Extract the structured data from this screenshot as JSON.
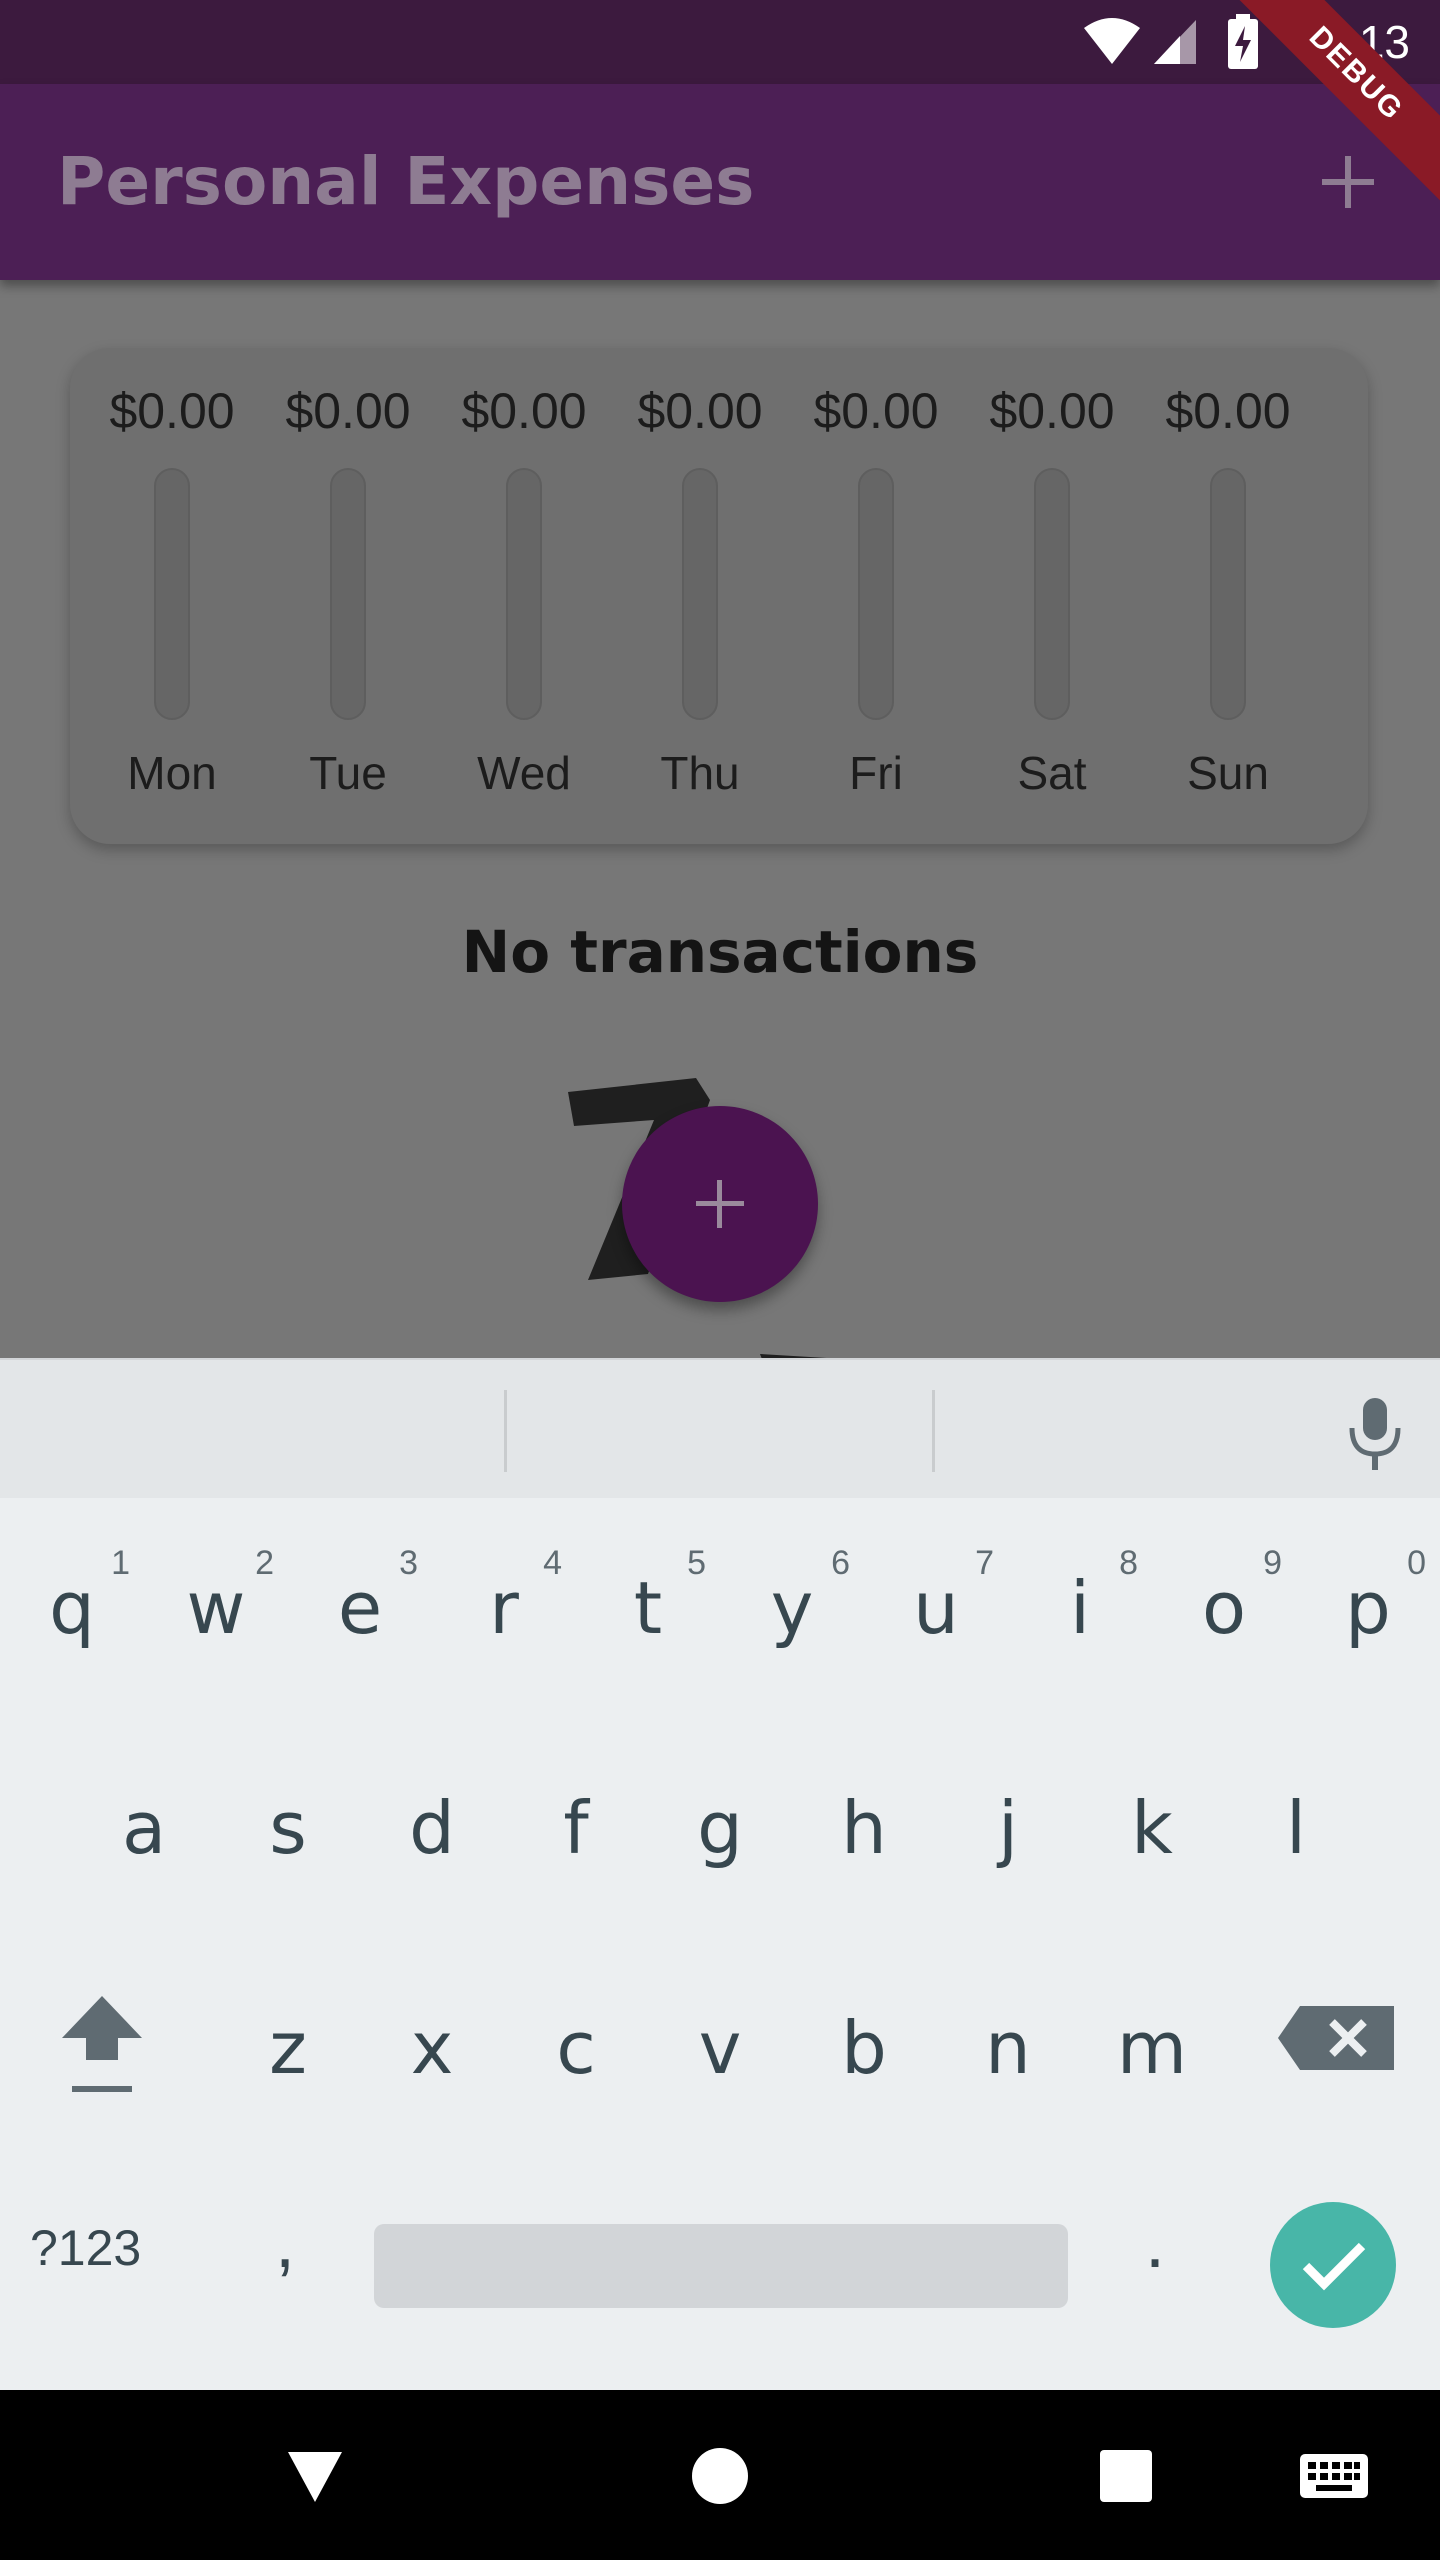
{
  "status_bar": {
    "time": "10:13",
    "icons": [
      "wifi-icon",
      "signal-icon",
      "battery-charging-icon"
    ]
  },
  "debug_banner": "DEBUG",
  "app_bar": {
    "title": "Personal Expenses",
    "action_icon": "add-icon"
  },
  "colors": {
    "primary": "#4c1f55",
    "status_bar": "#3c1a3e",
    "fab": "#4b1350",
    "keyboard_bg": "#eceff1",
    "enter_key": "#48b6a8"
  },
  "chart": {
    "days": [
      {
        "label": "Mon",
        "amount": "$0.00",
        "fill_fraction": 0
      },
      {
        "label": "Tue",
        "amount": "$0.00",
        "fill_fraction": 0
      },
      {
        "label": "Wed",
        "amount": "$0.00",
        "fill_fraction": 0
      },
      {
        "label": "Thu",
        "amount": "$0.00",
        "fill_fraction": 0
      },
      {
        "label": "Fri",
        "amount": "$0.00",
        "fill_fraction": 0
      },
      {
        "label": "Sat",
        "amount": "$0.00",
        "fill_fraction": 0
      },
      {
        "label": "Sun",
        "amount": "$0.00",
        "fill_fraction": 0
      }
    ]
  },
  "empty_state": {
    "message": "No transactions"
  },
  "fab": {
    "icon": "add-icon"
  },
  "keyboard": {
    "row1": [
      {
        "key": "q",
        "hint": "1"
      },
      {
        "key": "w",
        "hint": "2"
      },
      {
        "key": "e",
        "hint": "3"
      },
      {
        "key": "r",
        "hint": "4"
      },
      {
        "key": "t",
        "hint": "5"
      },
      {
        "key": "y",
        "hint": "6"
      },
      {
        "key": "u",
        "hint": "7"
      },
      {
        "key": "i",
        "hint": "8"
      },
      {
        "key": "o",
        "hint": "9"
      },
      {
        "key": "p",
        "hint": "0"
      }
    ],
    "row2": [
      "a",
      "s",
      "d",
      "f",
      "g",
      "h",
      "j",
      "k",
      "l"
    ],
    "row3": [
      "z",
      "x",
      "c",
      "v",
      "b",
      "n",
      "m"
    ],
    "symbols_label": "?123",
    "comma": ",",
    "period": "."
  }
}
